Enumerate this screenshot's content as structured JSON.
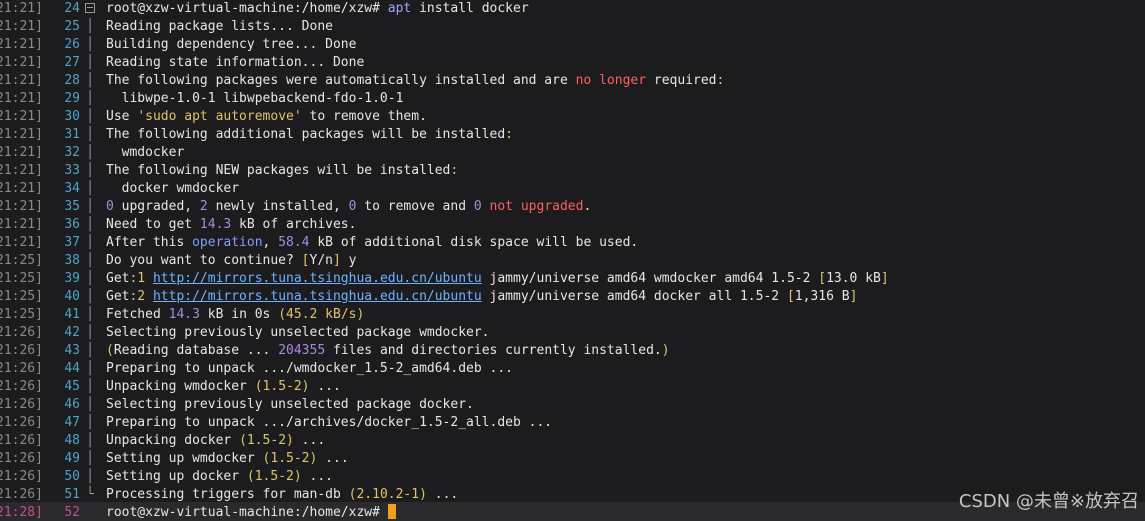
{
  "watermark": "CSDN @未曾※放弃召",
  "lines": [
    {
      "ts": "21:21]",
      "no": "24",
      "gutter": "fold",
      "segs": [
        {
          "t": "root@xzw-virtual-machine:/home/xzw# ",
          "c": ""
        },
        {
          "t": "apt",
          "c": "c-cmd"
        },
        {
          "t": " install docker",
          "c": ""
        }
      ]
    },
    {
      "ts": "21:21]",
      "no": "25",
      "gutter": "bar",
      "segs": [
        {
          "t": "Reading package lists... Done",
          "c": ""
        }
      ]
    },
    {
      "ts": "21:21]",
      "no": "26",
      "gutter": "bar",
      "segs": [
        {
          "t": "Building dependency tree... Done",
          "c": ""
        }
      ]
    },
    {
      "ts": "21:21]",
      "no": "27",
      "gutter": "bar",
      "segs": [
        {
          "t": "Reading state information... Done",
          "c": ""
        }
      ]
    },
    {
      "ts": "21:21]",
      "no": "28",
      "gutter": "bar",
      "segs": [
        {
          "t": "The following packages were automatically installed and are ",
          "c": ""
        },
        {
          "t": "no longer",
          "c": "c-red"
        },
        {
          "t": " required",
          "c": ""
        },
        {
          "t": ":",
          "c": "c-yel"
        }
      ]
    },
    {
      "ts": "21:21]",
      "no": "29",
      "gutter": "bar",
      "segs": [
        {
          "t": "  libwpe-1.0-1 libwpebackend-fdo-1.0-1",
          "c": ""
        }
      ]
    },
    {
      "ts": "21:21]",
      "no": "30",
      "gutter": "bar",
      "segs": [
        {
          "t": "Use ",
          "c": ""
        },
        {
          "t": "'sudo apt autoremove'",
          "c": "c-str"
        },
        {
          "t": " to remove them.",
          "c": ""
        }
      ]
    },
    {
      "ts": "21:21]",
      "no": "31",
      "gutter": "bar",
      "segs": [
        {
          "t": "The following additional packages will be installed",
          "c": ""
        },
        {
          "t": ":",
          "c": "c-yel"
        }
      ]
    },
    {
      "ts": "21:21]",
      "no": "32",
      "gutter": "bar",
      "segs": [
        {
          "t": "  wmdocker",
          "c": ""
        }
      ]
    },
    {
      "ts": "21:21]",
      "no": "33",
      "gutter": "bar",
      "segs": [
        {
          "t": "The following NEW packages will be installed",
          "c": ""
        },
        {
          "t": ":",
          "c": "c-yel"
        }
      ]
    },
    {
      "ts": "21:21]",
      "no": "34",
      "gutter": "bar",
      "segs": [
        {
          "t": "  docker wmdocker",
          "c": ""
        }
      ]
    },
    {
      "ts": "21:21]",
      "no": "35",
      "gutter": "bar",
      "segs": [
        {
          "t": "0",
          "c": "c-num"
        },
        {
          "t": " upgraded, ",
          "c": ""
        },
        {
          "t": "2",
          "c": "c-num"
        },
        {
          "t": " newly installed, ",
          "c": ""
        },
        {
          "t": "0",
          "c": "c-num"
        },
        {
          "t": " to remove and ",
          "c": ""
        },
        {
          "t": "0",
          "c": "c-num"
        },
        {
          "t": " ",
          "c": ""
        },
        {
          "t": "not upgraded",
          "c": "c-red"
        },
        {
          "t": ".",
          "c": ""
        }
      ]
    },
    {
      "ts": "21:21]",
      "no": "36",
      "gutter": "bar",
      "segs": [
        {
          "t": "Need to get ",
          "c": ""
        },
        {
          "t": "14.3",
          "c": "c-num"
        },
        {
          "t": " kB of archives.",
          "c": ""
        }
      ]
    },
    {
      "ts": "21:21]",
      "no": "37",
      "gutter": "bar",
      "segs": [
        {
          "t": "After this ",
          "c": ""
        },
        {
          "t": "operation",
          "c": "c-blue"
        },
        {
          "t": ", ",
          "c": ""
        },
        {
          "t": "58.4",
          "c": "c-num"
        },
        {
          "t": " kB of additional disk space will be used.",
          "c": ""
        }
      ]
    },
    {
      "ts": "21:25]",
      "no": "38",
      "gutter": "bar",
      "segs": [
        {
          "t": "Do you want to continue? ",
          "c": ""
        },
        {
          "t": "[",
          "c": "c-yel"
        },
        {
          "t": "Y/n",
          "c": ""
        },
        {
          "t": "]",
          "c": "c-yel"
        },
        {
          "t": " y",
          "c": ""
        }
      ]
    },
    {
      "ts": "21:25]",
      "no": "39",
      "gutter": "bar",
      "segs": [
        {
          "t": "Get",
          "c": ""
        },
        {
          "t": ":1",
          "c": "c-yel"
        },
        {
          "t": " ",
          "c": ""
        },
        {
          "t": "http://mirrors.tuna.tsinghua.edu.cn/ubuntu",
          "c": "c-link"
        },
        {
          "t": " jammy/universe amd64 wmdocker amd64 1.5-2 ",
          "c": ""
        },
        {
          "t": "[",
          "c": "c-yel"
        },
        {
          "t": "13.0 kB",
          "c": ""
        },
        {
          "t": "]",
          "c": "c-yel"
        }
      ]
    },
    {
      "ts": "21:25]",
      "no": "40",
      "gutter": "bar",
      "segs": [
        {
          "t": "Get",
          "c": ""
        },
        {
          "t": ":2",
          "c": "c-yel"
        },
        {
          "t": " ",
          "c": ""
        },
        {
          "t": "http://mirrors.tuna.tsinghua.edu.cn/ubuntu",
          "c": "c-link"
        },
        {
          "t": " jammy/universe amd64 docker all 1.5-2 ",
          "c": ""
        },
        {
          "t": "[",
          "c": "c-yel"
        },
        {
          "t": "1,316 B",
          "c": ""
        },
        {
          "t": "]",
          "c": "c-yel"
        }
      ]
    },
    {
      "ts": "21:25]",
      "no": "41",
      "gutter": "bar",
      "segs": [
        {
          "t": "Fetched ",
          "c": ""
        },
        {
          "t": "14.3",
          "c": "c-num"
        },
        {
          "t": " kB in 0s ",
          "c": ""
        },
        {
          "t": "(45.2 kB/s)",
          "c": "c-yel"
        }
      ]
    },
    {
      "ts": "21:26]",
      "no": "42",
      "gutter": "bar",
      "segs": [
        {
          "t": "Selecting previously unselected package wmdocker.",
          "c": ""
        }
      ]
    },
    {
      "ts": "21:26]",
      "no": "43",
      "gutter": "bar",
      "segs": [
        {
          "t": "(",
          "c": "c-yel"
        },
        {
          "t": "Reading database ... ",
          "c": ""
        },
        {
          "t": "204355",
          "c": "c-num"
        },
        {
          "t": " files and directories currently installed.",
          "c": ""
        },
        {
          "t": ")",
          "c": "c-yel"
        }
      ]
    },
    {
      "ts": "21:26]",
      "no": "44",
      "gutter": "bar",
      "segs": [
        {
          "t": "Preparing to unpack .../wmdocker_1.5-2_amd64.deb ...",
          "c": ""
        }
      ]
    },
    {
      "ts": "21:26]",
      "no": "45",
      "gutter": "bar",
      "segs": [
        {
          "t": "Unpacking wmdocker ",
          "c": ""
        },
        {
          "t": "(1.5-2)",
          "c": "c-yel"
        },
        {
          "t": " ...",
          "c": ""
        }
      ]
    },
    {
      "ts": "21:26]",
      "no": "46",
      "gutter": "bar",
      "segs": [
        {
          "t": "Selecting previously unselected package docker.",
          "c": ""
        }
      ]
    },
    {
      "ts": "21:26]",
      "no": "47",
      "gutter": "bar",
      "segs": [
        {
          "t": "Preparing to unpack .../archives/docker_1.5-2_all.deb ...",
          "c": ""
        }
      ]
    },
    {
      "ts": "21:26]",
      "no": "48",
      "gutter": "bar",
      "segs": [
        {
          "t": "Unpacking docker ",
          "c": ""
        },
        {
          "t": "(1.5-2)",
          "c": "c-yel"
        },
        {
          "t": " ...",
          "c": ""
        }
      ]
    },
    {
      "ts": "21:26]",
      "no": "49",
      "gutter": "bar",
      "segs": [
        {
          "t": "Setting up wmdocker ",
          "c": ""
        },
        {
          "t": "(1.5-2)",
          "c": "c-yel"
        },
        {
          "t": " ...",
          "c": ""
        }
      ]
    },
    {
      "ts": "21:26]",
      "no": "50",
      "gutter": "bar",
      "segs": [
        {
          "t": "Setting up docker ",
          "c": ""
        },
        {
          "t": "(1.5-2)",
          "c": "c-yel"
        },
        {
          "t": " ...",
          "c": ""
        }
      ]
    },
    {
      "ts": "21:26]",
      "no": "51",
      "gutter": "end",
      "segs": [
        {
          "t": "Processing triggers for man-db ",
          "c": ""
        },
        {
          "t": "(2.10.2-1)",
          "c": "c-yel"
        },
        {
          "t": " ...",
          "c": ""
        }
      ]
    },
    {
      "ts": "21:28]",
      "no": "52",
      "gutter": "none",
      "current": true,
      "segs": [
        {
          "t": "root@xzw-virtual-machine:/home/xzw# ",
          "c": ""
        }
      ]
    }
  ]
}
